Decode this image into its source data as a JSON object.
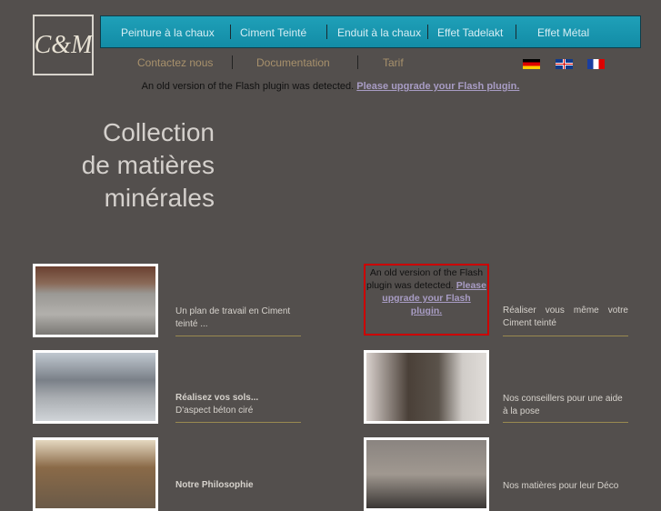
{
  "logo": {
    "text": "C&M"
  },
  "nav": {
    "items": [
      "Peinture à la chaux",
      "Ciment Teinté",
      "Enduit à la chaux",
      "Effet Tadelakt",
      "Effet Métal"
    ]
  },
  "subnav": {
    "items": [
      "Contactez nous",
      "Documentation",
      "Tarif"
    ]
  },
  "languages": [
    "Deutsch",
    "English",
    "Français"
  ],
  "flash": {
    "text": "An old version of the Flash plugin was detected.",
    "link": "Please upgrade your Flash plugin."
  },
  "title": {
    "line1": "Collection",
    "line2": "de matières",
    "line3": "minérales"
  },
  "left_items": [
    {
      "bold": "",
      "text": "Un plan de travail en Ciment teinté ..."
    },
    {
      "bold": "Réalisez vos sols...",
      "text": "D'aspect béton ciré"
    },
    {
      "bold": "Notre Philosophie",
      "text": ""
    }
  ],
  "right_items": [
    {
      "text": "Réaliser vous même votre Ciment teinté"
    },
    {
      "text": "Nos conseillers pour une aide à la pose"
    },
    {
      "text": "Nos matières pour leur Déco"
    }
  ]
}
